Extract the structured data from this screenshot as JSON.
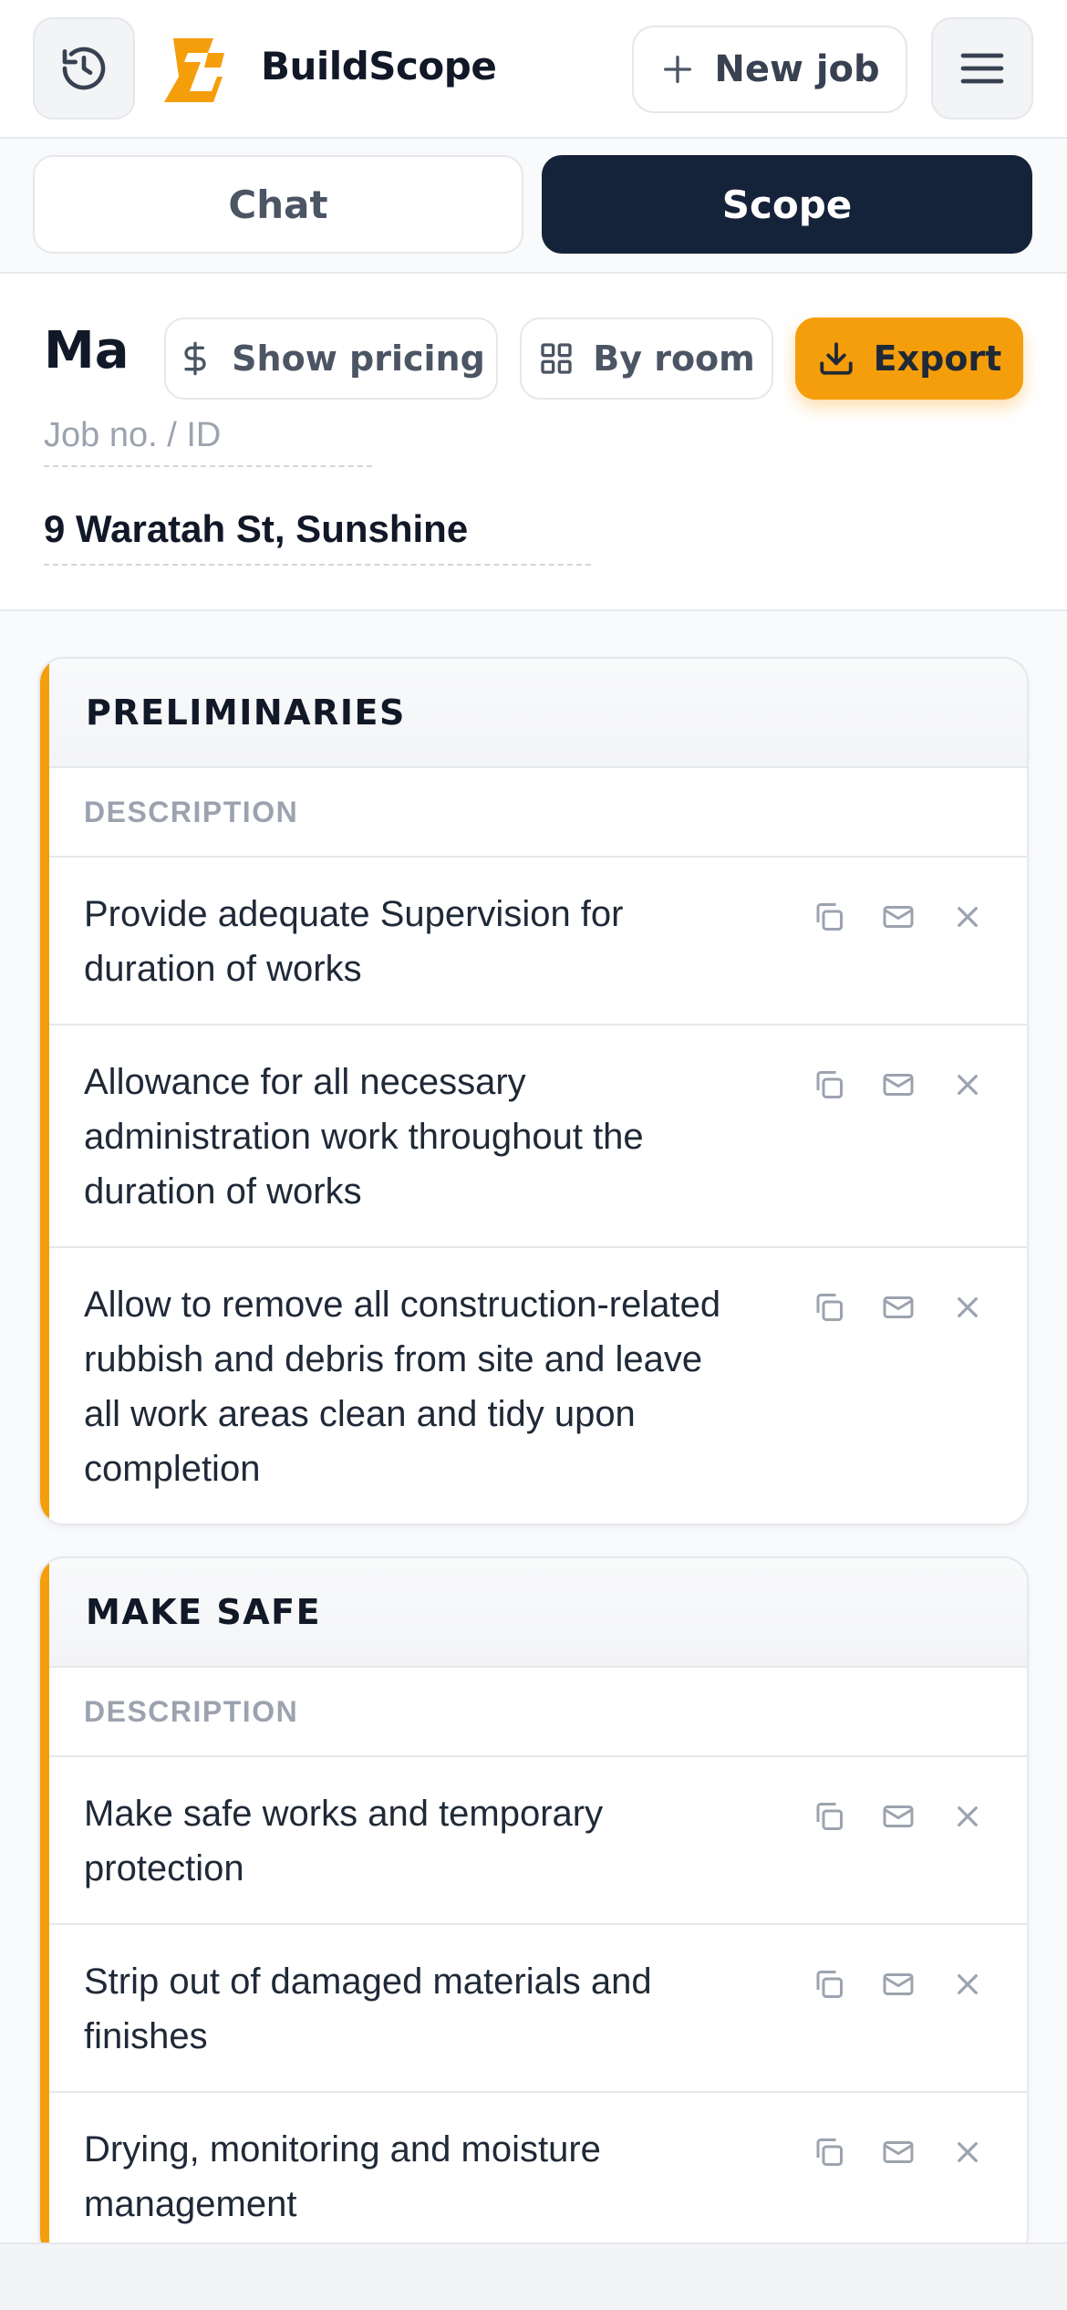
{
  "app": {
    "brand": "BuildScope",
    "new_job_label": "New job",
    "icons": {
      "history": "history-icon",
      "menu": "hamburger-menu-icon",
      "plus": "plus-icon"
    }
  },
  "tabs": [
    {
      "label": "Chat",
      "active": false
    },
    {
      "label": "Scope",
      "active": true
    }
  ],
  "job": {
    "title": "Ma",
    "job_id_placeholder": "Job no. / ID",
    "address": "9 Waratah St, Sunshine",
    "actions": {
      "pricing_label": "Show pricing",
      "room_label": "By room",
      "export_label": "Export"
    }
  },
  "sections": [
    {
      "title": "PRELIMINARIES",
      "column_header": "DESCRIPTION",
      "items": [
        "Provide adequate Supervision for duration of works",
        "Allowance for all necessary administration work throughout the duration of works",
        "Allow to remove all construction-related rubbish and debris from site and leave all work areas clean and tidy upon completion"
      ]
    },
    {
      "title": "MAKE SAFE",
      "column_header": "DESCRIPTION",
      "items": [
        "Make safe works and temporary protection",
        "Strip out of damaged materials and finishes",
        "Drying, monitoring and moisture management"
      ]
    }
  ],
  "colors": {
    "accent": "#f59e0b",
    "dark": "#15233a",
    "border": "#e5e7eb",
    "muted": "#9ca3af"
  }
}
